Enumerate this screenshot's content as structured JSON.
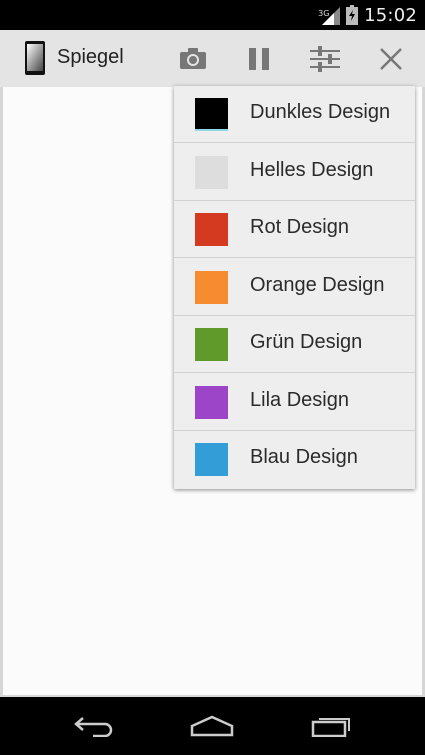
{
  "status_bar": {
    "network": "3G",
    "time": "15:02"
  },
  "action_bar": {
    "title": "Spiegel",
    "icons": [
      "phone-icon",
      "camera-icon",
      "pause-icon",
      "sliders-icon",
      "close-icon"
    ]
  },
  "theme_menu": {
    "items": [
      {
        "label": "Dunkles Design",
        "color": "#000000"
      },
      {
        "label": "Helles Design",
        "color": "#dddddd"
      },
      {
        "label": "Rot Design",
        "color": "#d33a1f"
      },
      {
        "label": "Orange Design",
        "color": "#f68c2f"
      },
      {
        "label": "Grün Design",
        "color": "#5f9a2b"
      },
      {
        "label": "Lila Design",
        "color": "#9c45c9"
      },
      {
        "label": "Blau Design",
        "color": "#329dd6"
      }
    ]
  },
  "nav_bar": {
    "icons": [
      "back-icon",
      "home-icon",
      "recent-apps-icon"
    ]
  }
}
